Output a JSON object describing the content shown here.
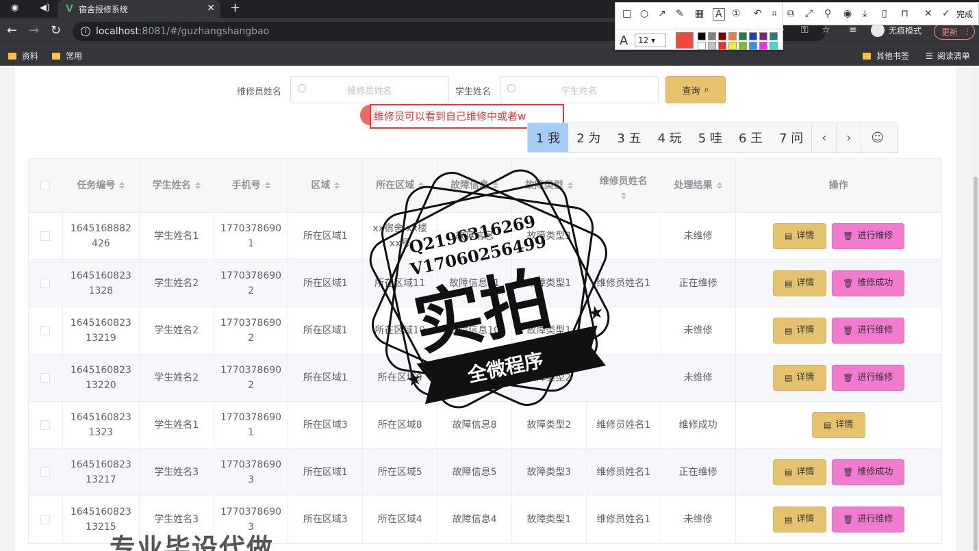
{
  "browser": {
    "tab_title": "宿舍报修系统",
    "url_host": "localhost",
    "url_path": ":8081/#/guzhangshangbao",
    "incognito_label": "无痕模式",
    "update_label": "更新",
    "bookmarks": [
      "资料",
      "常用"
    ],
    "other_bookmarks": "其他书签",
    "reading_list": "阅读清单"
  },
  "screenshot_tool": {
    "font_size": "12",
    "done_label": "完成",
    "active_color": "#f04a3c"
  },
  "search": {
    "repairman_label": "维修员姓名",
    "repairman_placeholder": "维修员姓名",
    "student_label": "学生姓名",
    "student_placeholder": "学生姓名",
    "query_label": "查询"
  },
  "annotation": {
    "text": "维修员可以看到自己维修中或者w",
    "ime_candidates": [
      "1 我",
      "2 为",
      "3 五",
      "4 玩",
      "5 哇",
      "6 王",
      "7 问"
    ]
  },
  "table": {
    "headers": [
      "任务编号",
      "学生姓名",
      "手机号",
      "区域",
      "所在区域",
      "故障信息",
      "故障类型",
      "维修员姓名",
      "处理结果",
      "操作"
    ],
    "rows": [
      {
        "id": "1645168882426",
        "student": "学生姓名1",
        "phone": "17703786901",
        "area": "所在区域1",
        "location": "xx宿舍 xx楼xx号",
        "fault": "故障信息",
        "type": "故障类型3",
        "repairman": "",
        "result": "未维修",
        "detail": "详情",
        "action": "进行维修"
      },
      {
        "id": "16451608231328",
        "student": "学生姓名2",
        "phone": "17703786902",
        "area": "所在区域1",
        "location": "所在区域11",
        "fault": "故障信息11",
        "type": "故障类型1",
        "repairman": "维修员姓名1",
        "result": "正在维修",
        "detail": "详情",
        "action": "维修成功"
      },
      {
        "id": "164516082313219",
        "student": "学生姓名2",
        "phone": "17703786902",
        "area": "所在区域1",
        "location": "所在区域10",
        "fault": "故障信息10",
        "type": "故障类型1",
        "repairman": "",
        "result": "未维修",
        "detail": "详情",
        "action": "进行维修"
      },
      {
        "id": "164516082313220",
        "student": "学生姓名2",
        "phone": "17703786902",
        "area": "所在区域1",
        "location": "所在区域9",
        "fault": "故障信息9",
        "type": "故障类型2",
        "repairman": "",
        "result": "未维修",
        "detail": "详情",
        "action": "进行维修"
      },
      {
        "id": "16451608231323",
        "student": "学生姓名1",
        "phone": "17703786901",
        "area": "所在区域3",
        "location": "所在区域8",
        "fault": "故障信息8",
        "type": "故障类型2",
        "repairman": "维修员姓名1",
        "result": "维修成功",
        "detail": "详情",
        "action": ""
      },
      {
        "id": "164516082313217",
        "student": "学生姓名3",
        "phone": "17703786903",
        "area": "所在区域1",
        "location": "所在区域5",
        "fault": "故障信息5",
        "type": "故障类型3",
        "repairman": "维修员姓名1",
        "result": "正在维修",
        "detail": "详情",
        "action": "维修成功"
      },
      {
        "id": "164516082313215",
        "student": "学生姓名3",
        "phone": "17703786903",
        "area": "所在区域3",
        "location": "所在区域4",
        "fault": "故障信息4",
        "type": "故障类型1",
        "repairman": "维修员姓名1",
        "result": "未维修",
        "detail": "详情",
        "action": "进行维修"
      }
    ]
  },
  "watermark": {
    "contact1": "Q2196316269",
    "contact2": "V17060256499",
    "big_text": "实拍",
    "ribbon_text": "全微程序",
    "bottom_text": "专业毕设代做"
  }
}
